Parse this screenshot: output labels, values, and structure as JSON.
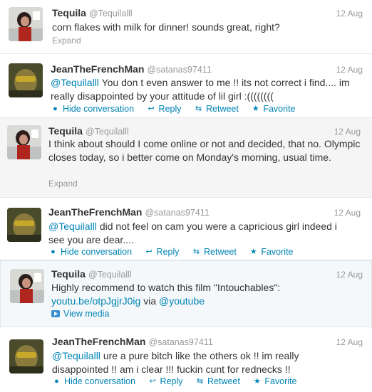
{
  "tweets": [
    {
      "name": "Tequila",
      "handle": "@Tequilalll",
      "date": "12 Aug",
      "text": "corn flakes with milk for dinner! sounds great, right?",
      "expand": "Expand"
    },
    {
      "name": "JeanTheFrenchMan",
      "handle": "@satanas97411",
      "date": "12 Aug",
      "mention": "@Tequilalll",
      "text": "You don t even answer to me !! its not correct i find.... im really disappointed by your attitude of lil girl :((((((((",
      "actions": {
        "hide": "Hide conversation",
        "reply": "Reply",
        "retweet": "Retweet",
        "favorite": "Favorite"
      }
    },
    {
      "name": "Tequila",
      "handle": "@Tequilalll",
      "date": "12 Aug",
      "text": "I think about should I come online or not and decided, that no. Olympic closes today, so i better come on Monday's morning, usual time.",
      "expand": "Expand"
    },
    {
      "name": "JeanTheFrenchMan",
      "handle": "@satanas97411",
      "date": "12 Aug",
      "mention": "@Tequilalll",
      "text": "did not feel on cam you were a capricious girl indeed i see you are dear....",
      "actions": {
        "hide": "Hide conversation",
        "reply": "Reply",
        "retweet": "Retweet",
        "favorite": "Favorite"
      }
    },
    {
      "name": "Tequila",
      "handle": "@Tequilalll",
      "date": "12 Aug",
      "text": "Highly recommend to watch this film \"Intouchables\":",
      "link": "youtu.be/otpJgjrJ0ig",
      "via": "via",
      "via_mention": "@youtube",
      "media": "View media"
    },
    {
      "name": "JeanTheFrenchMan",
      "handle": "@satanas97411",
      "date": "12 Aug",
      "mention": "@Tequilalll",
      "text": "ure a pure bitch like the others ok !! im really disappointed !! am i clear !!! fuckin cunt for rednecks !!",
      "actions": {
        "hide": "Hide conversation",
        "reply": "Reply",
        "retweet": "Retweet",
        "favorite": "Favorite"
      }
    }
  ]
}
